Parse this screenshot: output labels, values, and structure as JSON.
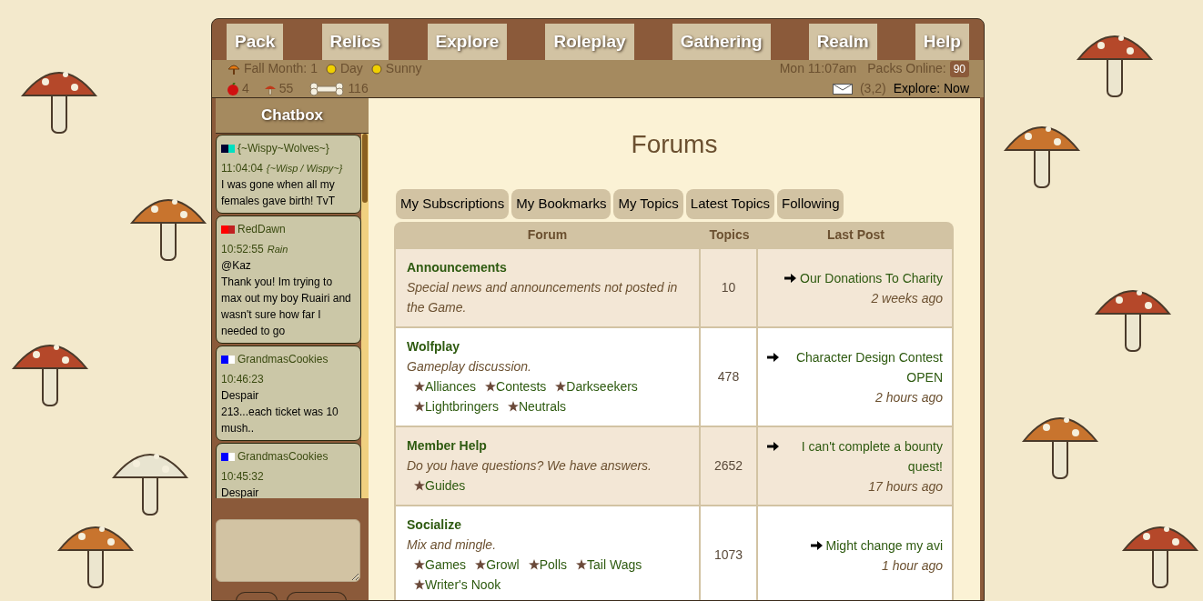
{
  "nav": [
    "Pack",
    "Relics",
    "Explore",
    "Roleplay",
    "Gathering",
    "Realm",
    "Help"
  ],
  "status": {
    "season": "Fall Month: 1",
    "time_of_day": "Day",
    "weather": "Sunny",
    "clock": "Mon 11:07am",
    "packs_online_label": "Packs Online:",
    "packs_online": "90",
    "apples": "4",
    "mushrooms": "55",
    "bones": "116",
    "coords": "(3,2)",
    "explore": "Explore: Now"
  },
  "chatbox": {
    "title": "Chatbox",
    "messages": [
      {
        "name": "{~Wispy~Wolves~}",
        "flag": [
          {
            "color": "#000033"
          },
          {
            "color": "#00e0c0"
          }
        ],
        "time": "11:04:04",
        "sender": "{~Wisp / Wispy~}",
        "text": [
          "I was gone when all my females gave birth! TvT"
        ]
      },
      {
        "name": "RedDawn",
        "flag": [
          {
            "color": "#ff0000"
          },
          {
            "color": "#c02020"
          }
        ],
        "time": "10:52:55",
        "sender": "Rain",
        "text": [
          "@Kaz",
          "Thank you! Im trying to max out my boy Ruairi and wasn't sure how far I needed to go"
        ]
      },
      {
        "name": "GrandmasCookies",
        "flag": [
          {
            "color": "#0000ff"
          },
          {
            "color": "#ffffff"
          }
        ],
        "time": "10:46:23",
        "text": [
          "Despair",
          "213...each ticket was 10 mush.."
        ]
      },
      {
        "name": "GrandmasCookies",
        "flag": [
          {
            "color": "#0000ff"
          },
          {
            "color": "#ffffff"
          }
        ],
        "time": "10:45:32",
        "text": [
          "Despair"
        ]
      }
    ]
  },
  "page_title": "Forums",
  "tabs": [
    "My Subscriptions",
    "My Bookmarks",
    "My Topics",
    "Latest Topics",
    "Following"
  ],
  "table": {
    "columns": [
      "Forum",
      "Topics",
      "Last Post"
    ],
    "rows": [
      {
        "name": "Announcements",
        "description": "Special news and announcements not posted in the Game.",
        "subforums": [],
        "topics": "10",
        "last_post": "Our Donations To Charity",
        "last_time": "2 weeks ago"
      },
      {
        "name": "Wolfplay",
        "description": "Gameplay discussion.",
        "subforums": [
          "Alliances",
          "Contests",
          "Darkseekers",
          "Lightbringers",
          "Neutrals"
        ],
        "topics": "478",
        "last_post": "Character Design Contest OPEN",
        "last_time": "2 hours ago"
      },
      {
        "name": "Member Help",
        "description": "Do you have questions? We have answers.",
        "subforums": [
          "Guides"
        ],
        "topics": "2652",
        "last_post": "I can't complete a bounty quest!",
        "last_time": "17 hours ago"
      },
      {
        "name": "Socialize",
        "description": "Mix and mingle.",
        "subforums": [
          "Games",
          "Growl",
          "Polls",
          "Tail Wags",
          "Writer's Nook"
        ],
        "topics": "1073",
        "last_post": "Might change my avi",
        "last_time": "1 hour ago"
      }
    ]
  }
}
